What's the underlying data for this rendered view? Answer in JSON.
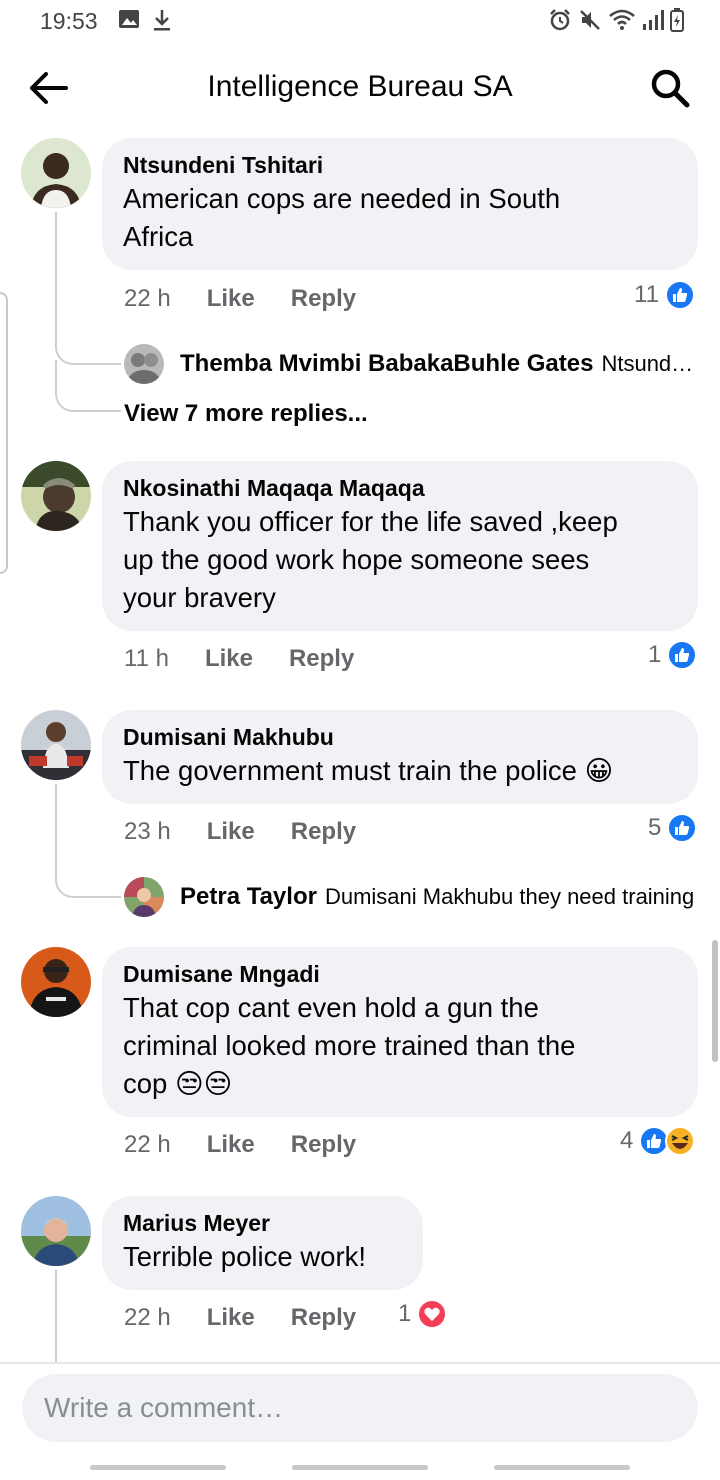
{
  "status_bar": {
    "time": "19:53"
  },
  "header": {
    "title": "Intelligence Bureau SA"
  },
  "like_label": "Like",
  "reply_label": "Reply",
  "comments": [
    {
      "author": "Ntsundeni Tshitari",
      "text": [
        "American cops are needed in South",
        "Africa"
      ],
      "time": "22 h",
      "reaction_count": "11",
      "reactions": [
        "like"
      ],
      "reply_preview": {
        "author": "Themba Mvimbi BabakaBuhle Gates",
        "snippet": "Ntsundeni Tshitari"
      },
      "view_more": "View 7 more replies..."
    },
    {
      "author": "Nkosinathi Maqaqa Maqaqa",
      "text": [
        "Thank you officer for the life saved ,keep",
        "up the good work hope someone sees",
        "your bravery"
      ],
      "time": "11 h",
      "reaction_count": "1",
      "reactions": [
        "like"
      ]
    },
    {
      "author": "Dumisani Makhubu",
      "text": [
        "The government must train the police 😀"
      ],
      "time": "23 h",
      "reaction_count": "5",
      "reactions": [
        "like"
      ],
      "reply_preview": {
        "author": "Petra Taylor",
        "snippet": "Dumisani Makhubu they need training"
      }
    },
    {
      "author": "Dumisane Mngadi",
      "text": [
        "That cop cant even hold a gun the",
        "criminal looked more trained than the",
        "cop 😒😒"
      ],
      "time": "22 h",
      "reaction_count": "4",
      "reactions": [
        "like",
        "haha"
      ]
    },
    {
      "author": "Marius Meyer",
      "text": [
        "Terrible police work!"
      ],
      "time": "22 h",
      "reaction_count": "1",
      "reactions": [
        "love"
      ]
    }
  ],
  "composer": {
    "placeholder": "Write a comment…"
  },
  "colors": {
    "like_blue": "#1877f2",
    "love_red": "#f33e58",
    "haha_yellow": "#f7b125",
    "bubble_bg": "#f0f2f5",
    "meta_grey": "#65676b"
  }
}
